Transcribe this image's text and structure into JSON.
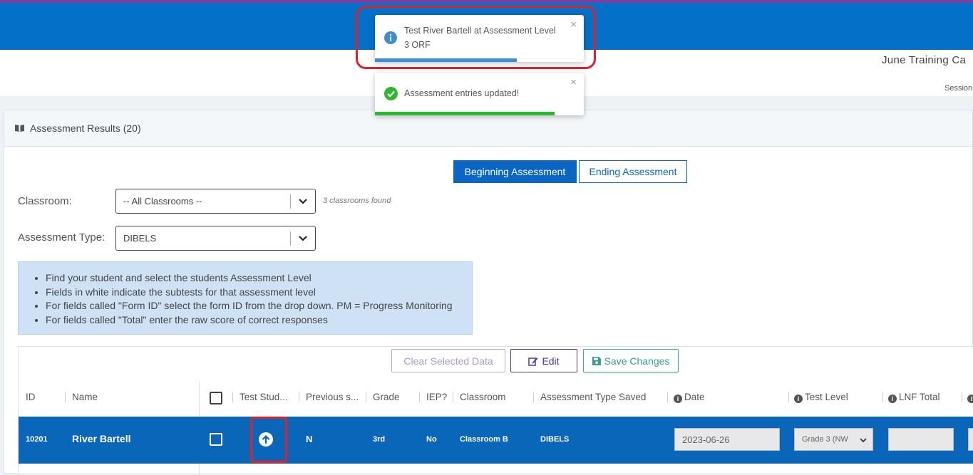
{
  "header": {
    "title": "June Training Ca",
    "session": "Session"
  },
  "card": {
    "title": "Assessment Results (20)"
  },
  "tabs": {
    "beginning": "Beginning Assessment",
    "ending": "Ending Assessment"
  },
  "filters": {
    "classroom_label": "Classroom:",
    "classroom_value": "-- All Classrooms --",
    "classrooms_found": "3 classrooms found",
    "assessment_type_label": "Assessment Type:",
    "assessment_type_value": "DIBELS"
  },
  "instructions": [
    "Find your student and select the students Assessment Level",
    "Fields in white indicate the subtests for that assessment level",
    "For fields called \"Form ID\" select the form ID from the drop down. PM = Progress Monitoring",
    "For fields called \"Total\" enter the raw score of correct responses"
  ],
  "toolbar": {
    "clear": "Clear Selected Data",
    "edit": "Edit",
    "save": "Save Changes"
  },
  "table": {
    "headers": {
      "id": "ID",
      "name": "Name",
      "test_student": "Test Stud...",
      "previous": "Previous s...",
      "grade": "Grade",
      "iep": "IEP?",
      "classroom": "Classroom",
      "assessment_type_saved": "Assessment Type Saved",
      "date": "Date",
      "test_level": "Test Level",
      "lnf_total": "LNF Total"
    },
    "rows": [
      {
        "id": "10201",
        "name": "River Bartell",
        "previous": "N",
        "grade": "3rd",
        "iep": "No",
        "classroom": "Classroom B",
        "assessment_type_saved": "DIBELS",
        "date": "2023-06-26",
        "test_level": "Grade 3 (NW",
        "lnf_total": ""
      }
    ]
  },
  "toasts": {
    "info_line1": "Test River Bartell at Assessment Level",
    "info_line2": "3 ORF",
    "success": "Assessment entries updated!",
    "close": "×",
    "info_progress": 0.68,
    "success_progress": 0.86
  },
  "colors": {
    "brand_blue": "#0570c8",
    "row_selected": "#0a66b8",
    "info_toast_bar": "#3e8ed0",
    "success_toast_bar": "#2db92d",
    "highlight_red": "#e0202a"
  }
}
